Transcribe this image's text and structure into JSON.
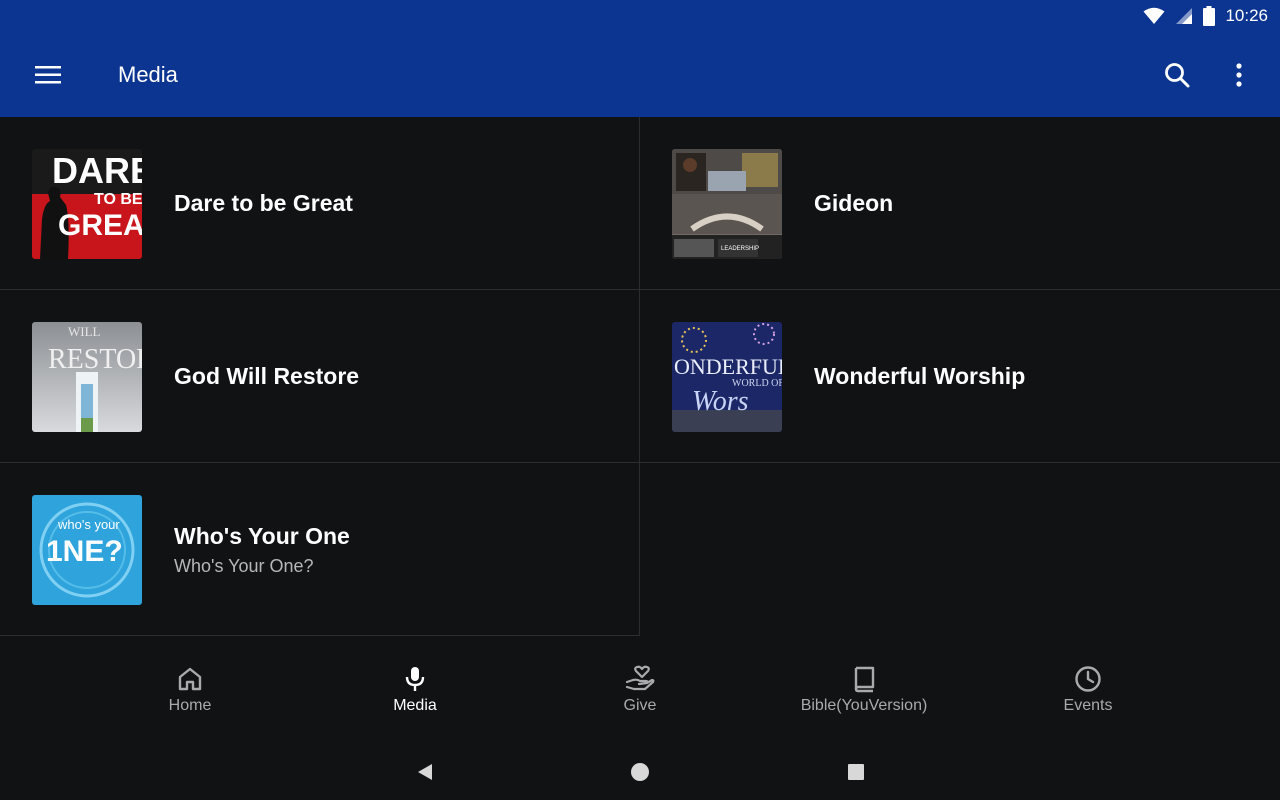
{
  "status": {
    "time": "10:26"
  },
  "appbar": {
    "title": "Media"
  },
  "media": {
    "items": [
      {
        "title": "Dare to be Great",
        "subtitle": ""
      },
      {
        "title": "Gideon",
        "subtitle": ""
      },
      {
        "title": "God Will Restore",
        "subtitle": ""
      },
      {
        "title": "Wonderful Worship",
        "subtitle": ""
      },
      {
        "title": "Who's Your One",
        "subtitle": "Who's Your One?"
      }
    ],
    "thumb_text": {
      "dare": [
        "DARE",
        "TO BE",
        "GREAT"
      ],
      "restore": [
        "WILL",
        "RESTORE"
      ],
      "worship": [
        "ONDERFUL",
        "WORLD OF",
        "Wors"
      ],
      "gideon": [
        "LEADERSHIP"
      ],
      "one": [
        "who's your",
        "1NE?"
      ]
    }
  },
  "nav": {
    "items": [
      {
        "label": "Home",
        "icon": "home-icon"
      },
      {
        "label": "Media",
        "icon": "microphone-icon"
      },
      {
        "label": "Give",
        "icon": "give-heart-hand-icon"
      },
      {
        "label": "Bible(YouVersion)",
        "icon": "book-icon"
      },
      {
        "label": "Events",
        "icon": "clock-icon"
      }
    ],
    "active_index": 1
  },
  "colors": {
    "primary": "#0b3591",
    "background": "#111214",
    "divider": "#2c2d30",
    "inactive": "#a9aaad"
  }
}
